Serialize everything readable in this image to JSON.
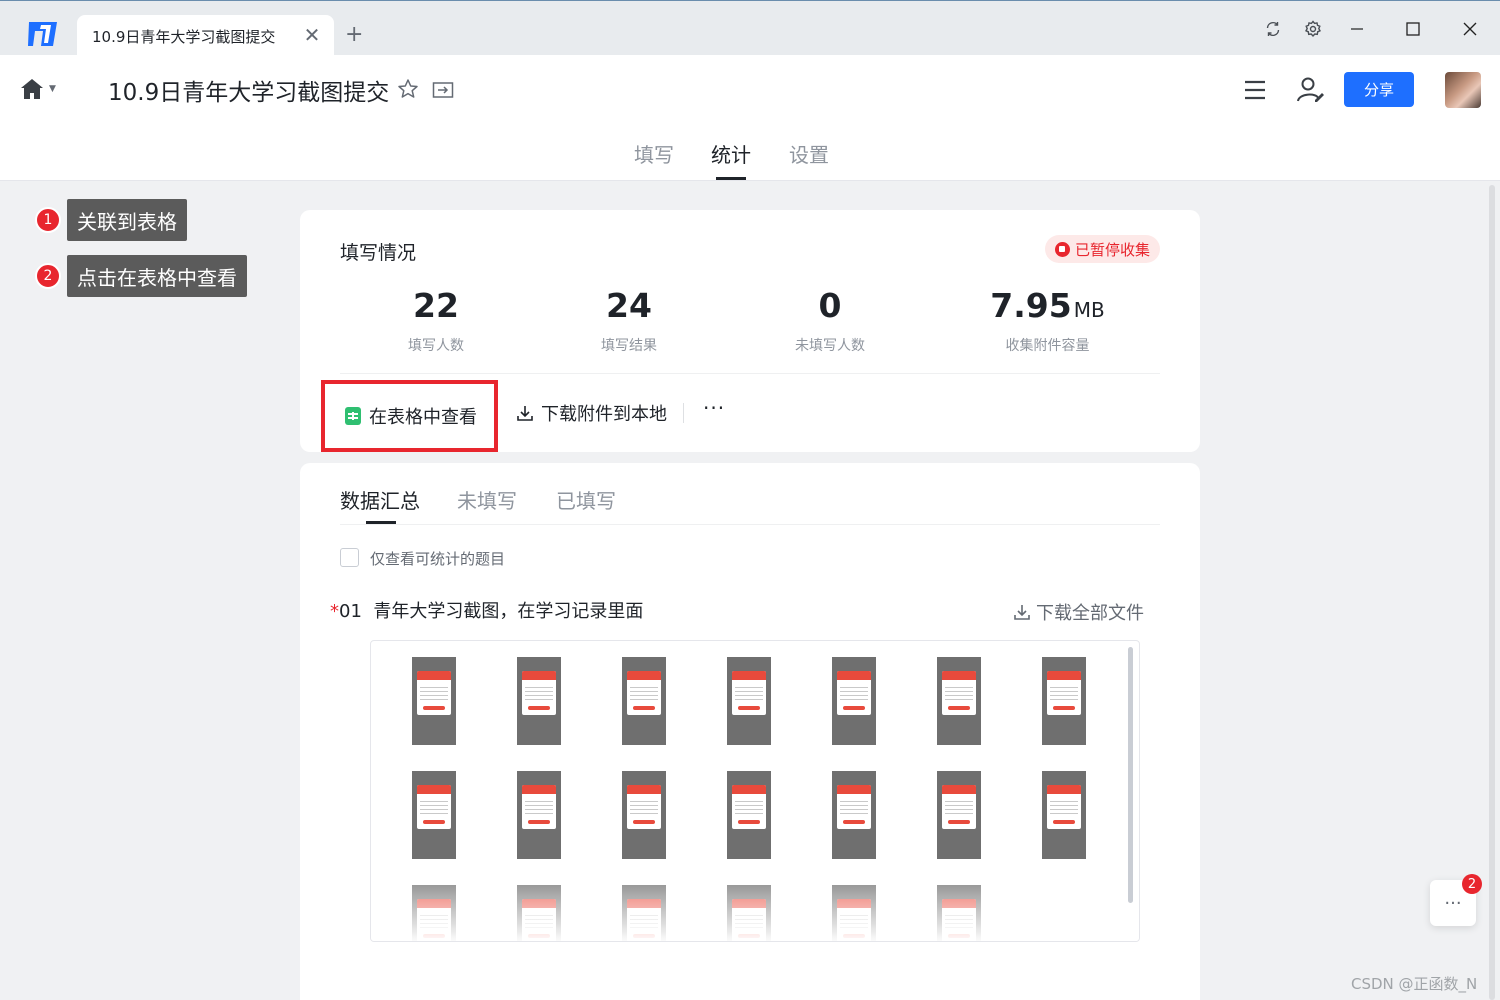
{
  "window": {
    "tab_title": "10.9日青年大学习截图提交",
    "tab_close": "✕",
    "tab_add": "+"
  },
  "header": {
    "doc_title": "10.9日青年大学习截图提交",
    "share_label": "分享"
  },
  "nav_tabs": [
    "填写",
    "统计",
    "设置"
  ],
  "annotations": [
    {
      "num": "1",
      "label": "关联到表格"
    },
    {
      "num": "2",
      "label": "点击在表格中查看"
    }
  ],
  "summary": {
    "title": "填写情况",
    "status": "已暂停收集",
    "stats": [
      {
        "value": "22",
        "unit": "",
        "label": "填写人数"
      },
      {
        "value": "24",
        "unit": "",
        "label": "填写结果"
      },
      {
        "value": "0",
        "unit": "",
        "label": "未填写人数"
      },
      {
        "value": "7.95",
        "unit": "MB",
        "label": "收集附件容量"
      }
    ],
    "actions": {
      "view_in_sheet": "在表格中查看",
      "download_local": "下载附件到本地",
      "more": "···"
    }
  },
  "details": {
    "tabs": [
      "数据汇总",
      "未填写",
      "已填写"
    ],
    "filter_label": "仅查看可统计的题目",
    "question": {
      "required_mark": "*",
      "number": "01",
      "text": "青年大学习截图，在学习记录里面",
      "download_all": "下载全部文件"
    },
    "thumbnail_count": 20
  },
  "float_badge": "2",
  "float_label": "···",
  "watermark": "CSDN @正函数_N",
  "colors": {
    "accent": "#1e6fff",
    "alert": "#e8262e",
    "sheet_green": "#2fbf71"
  }
}
